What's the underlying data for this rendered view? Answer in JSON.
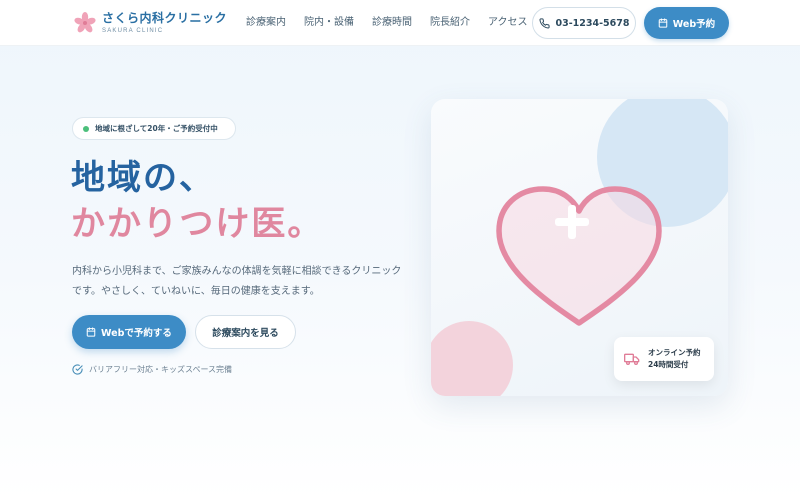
{
  "header": {
    "logo_title": "さくら内科クリニック",
    "logo_sub": "SAKURA CLINIC",
    "nav": [
      {
        "label": "診療案内"
      },
      {
        "label": "院内・設備"
      },
      {
        "label": "診療時間"
      },
      {
        "label": "院長紹介"
      },
      {
        "label": "アクセス"
      }
    ],
    "tel": "03-1234-5678",
    "web_reserve": "Web予約"
  },
  "hero": {
    "badge": "地域に根ざして20年・ご予約受付中",
    "title_line1": "地域の、",
    "title_line2": "かかりつけ医。",
    "lead": "内科から小児科まで、ご家族みんなの体調を気軽に相談できるクリニックです。やさしく、ていねいに、毎日の健康を支えます。",
    "cta_primary": "Webで予約する",
    "cta_secondary": "診療案内を見る",
    "note": "バリアフリー対応・キッズスペース完備"
  },
  "card": {
    "online_line1": "オンライン予約",
    "online_line2": "24時間受付"
  },
  "colors": {
    "primary": "#3d8cc6",
    "title_blue": "#2563a0",
    "accent_pink": "#e0879f",
    "badge_dot": "#4cbf7b"
  },
  "icons": {
    "logo": "sakura-flower-icon",
    "tel": "phone-icon",
    "calendar": "calendar-icon",
    "check": "check-circle-icon",
    "online": "truck-icon",
    "heart": "heart-cross-icon"
  }
}
